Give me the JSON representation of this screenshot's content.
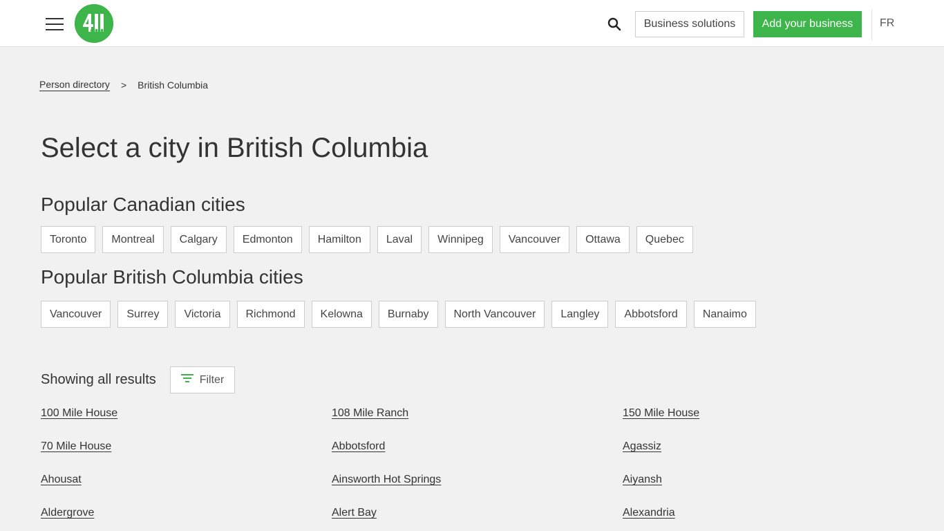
{
  "header": {
    "logo_label": "411",
    "business_solutions": "Business solutions",
    "add_business": "Add your business",
    "language": "FR",
    "accent_color": "#3db54a"
  },
  "breadcrumb": {
    "parent": "Person directory",
    "separator": ">",
    "current": "British Columbia"
  },
  "page_title": "Select a city in British Columbia",
  "popular_canadian": {
    "title": "Popular Canadian cities",
    "cities": [
      "Toronto",
      "Montreal",
      "Calgary",
      "Edmonton",
      "Hamilton",
      "Laval",
      "Winnipeg",
      "Vancouver",
      "Ottawa",
      "Quebec"
    ]
  },
  "popular_bc": {
    "title": "Popular British Columbia cities",
    "cities": [
      "Vancouver",
      "Surrey",
      "Victoria",
      "Richmond",
      "Kelowna",
      "Burnaby",
      "North Vancouver",
      "Langley",
      "Abbotsford",
      "Nanaimo"
    ]
  },
  "results": {
    "label": "Showing all results",
    "filter": "Filter"
  },
  "cities": [
    "100 Mile House",
    "108 Mile Ranch",
    "150 Mile House",
    "70 Mile House",
    "Abbotsford",
    "Agassiz",
    "Ahousat",
    "Ainsworth Hot Springs",
    "Aiyansh",
    "Aldergrove",
    "Alert Bay",
    "Alexandria"
  ]
}
